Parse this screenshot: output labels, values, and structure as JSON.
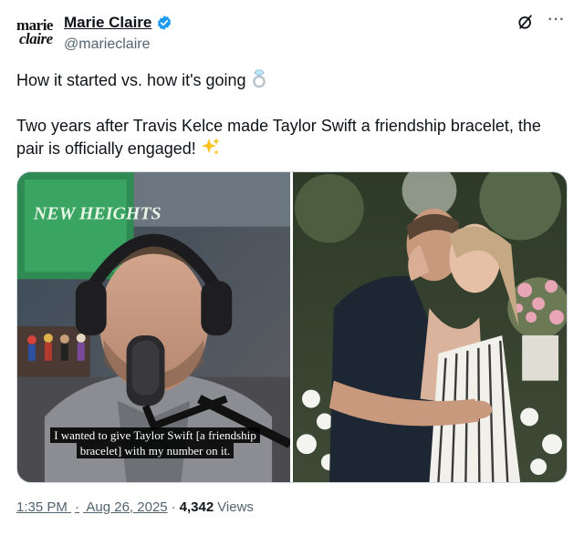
{
  "tweet": {
    "logo_line1": "marie",
    "logo_line2": "claire",
    "display_name": "Marie Claire",
    "handle": "@marieclaire",
    "text_line1": "How it started vs. how it's going",
    "text_line2": "Two years after Travis Kelce made Taylor Swift a friendship bracelet, the pair is officially engaged!",
    "emoji_ring": "💍",
    "emoji_sparkles": "✨"
  },
  "media": {
    "left_image": {
      "caption": "I wanted to give Taylor Swift [a friendship bracelet] with my number on it.",
      "poster_text": "NEW HEIGHTS"
    },
    "right_image": {}
  },
  "meta": {
    "time": "1:35 PM",
    "separator": "·",
    "date": "Aug 26, 2025",
    "views_count": "4,342",
    "views_label": "Views"
  },
  "icons": {
    "verified": "verified-badge-icon",
    "grok": "grok-icon",
    "more": "more-options-icon"
  },
  "colors": {
    "verified": "#1d9bf0",
    "secondary_text": "#536471",
    "primary_text": "#0f1419"
  }
}
